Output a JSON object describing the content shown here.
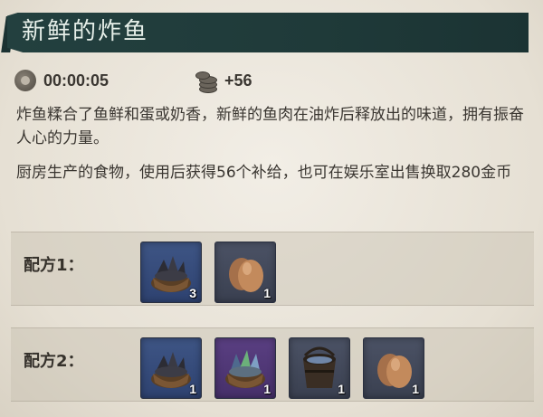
{
  "item": {
    "title": "新鲜的炸鱼",
    "time": "00:00:05",
    "supply": "+56",
    "description_1": "炸鱼糅合了鱼鲜和蛋或奶香，新鲜的鱼肉在油炸后释放出的味道，拥有振奋人心的力量。",
    "description_2": "厨房生产的食物，使用后获得56个补给，也可在娱乐室出售换取280金币"
  },
  "recipes": [
    {
      "label": "配方1：",
      "ingredients": [
        {
          "icon": "fish-basket-icon",
          "rarity": "blue",
          "count": "3"
        },
        {
          "icon": "egg-icon",
          "rarity": "gray",
          "count": "1"
        }
      ]
    },
    {
      "label": "配方2：",
      "ingredients": [
        {
          "icon": "fish-basket-icon",
          "rarity": "blue",
          "count": "1"
        },
        {
          "icon": "fresh-fish-basket-icon",
          "rarity": "purple",
          "count": "1"
        },
        {
          "icon": "oil-bucket-icon",
          "rarity": "gray",
          "count": "1"
        },
        {
          "icon": "egg-icon",
          "rarity": "gray",
          "count": "1"
        }
      ]
    }
  ]
}
